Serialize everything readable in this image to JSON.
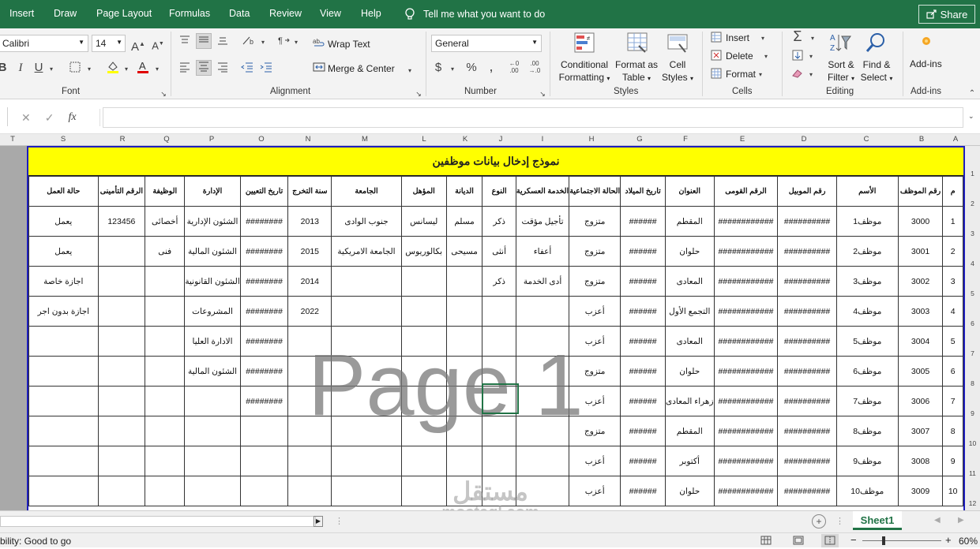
{
  "menu": {
    "tabs": [
      "Insert",
      "Draw",
      "Page Layout",
      "Formulas",
      "Data",
      "Review",
      "View",
      "Help"
    ],
    "tell_me": "Tell me what you want to do",
    "share": "Share"
  },
  "ribbon": {
    "font_name": "Calibri",
    "font_size": "14",
    "bold": "B",
    "italic": "I",
    "underline": "U",
    "wrap_text": "Wrap Text",
    "merge_center": "Merge & Center",
    "number_format": "General",
    "conditional_formatting": [
      "Conditional",
      "Formatting"
    ],
    "format_as_table": [
      "Format as",
      "Table"
    ],
    "cell_styles": [
      "Cell",
      "Styles"
    ],
    "insert": "Insert",
    "delete": "Delete",
    "format": "Format",
    "sort_filter": [
      "Sort &",
      "Filter"
    ],
    "find_select": [
      "Find &",
      "Select"
    ],
    "addins": "Add-ins",
    "groups": {
      "font": "Font",
      "alignment": "Alignment",
      "number": "Number",
      "styles": "Styles",
      "cells": "Cells",
      "editing": "Editing",
      "addins": "Add-ins"
    }
  },
  "formula_bar": {
    "fx": "fx",
    "value": ""
  },
  "columns": [
    "T",
    "S",
    "R",
    "Q",
    "P",
    "O",
    "N",
    "M",
    "L",
    "K",
    "J",
    "I",
    "H",
    "G",
    "F",
    "E",
    "D",
    "C",
    "B",
    "A"
  ],
  "row_numbers": [
    "1",
    "2",
    "3",
    "4",
    "5",
    "6",
    "7",
    "8",
    "9",
    "10",
    "11",
    "12"
  ],
  "sheet": {
    "title": "نموذج إدخال بيانات موظفين",
    "headers": [
      "حالة العمل",
      "الرقم التأمينى",
      "الوظيفة",
      "الإدارة",
      "تاريخ التعيين",
      "سنة التخرج",
      "الجامعة",
      "المؤهل",
      "الديانة",
      "النوع",
      "الخدمة العسكرية",
      "الحالة الاجتماعية",
      "تاريخ الميلاد",
      "العنوان",
      "الرقم القومى",
      "رقم الموبيل",
      "الأسم",
      "رقم الموظف",
      "م"
    ],
    "rows": [
      [
        "يعمل",
        "123456",
        "أخصائى",
        "الشئون الإدارية",
        "########",
        "2013",
        "جنوب الوادى",
        "ليسانس",
        "مسلم",
        "ذكر",
        "تأجيل مؤقت",
        "متزوج",
        "######",
        "المقطم",
        "############",
        "##########",
        "موظف1",
        "3000",
        "1"
      ],
      [
        "يعمل",
        "",
        "فنى",
        "الشئون المالية",
        "########",
        "2015",
        "الجامعة الامريكية",
        "بكالوريوس",
        "مسيحى",
        "أنثى",
        "أعفاء",
        "متزوج",
        "######",
        "حلوان",
        "############",
        "##########",
        "موظف2",
        "3001",
        "2"
      ],
      [
        "اجازة خاصة",
        "",
        "",
        "الشئون القانونية",
        "########",
        "2014",
        "",
        "",
        "",
        "ذكر",
        "أدى الخدمة",
        "متزوج",
        "######",
        "المعادى",
        "############",
        "##########",
        "موظف3",
        "3002",
        "3"
      ],
      [
        "اجازة بدون اجر",
        "",
        "",
        "المشروعات",
        "########",
        "2022",
        "",
        "",
        "",
        "",
        "",
        "أعزب",
        "######",
        "التجمع الأول",
        "############",
        "##########",
        "موظف4",
        "3003",
        "4"
      ],
      [
        "",
        "",
        "",
        "الادارة العليا",
        "########",
        "",
        "",
        "",
        "",
        "",
        "",
        "أعزب",
        "######",
        "المعادى",
        "############",
        "##########",
        "موظف5",
        "3004",
        "5"
      ],
      [
        "",
        "",
        "",
        "الشئون المالية",
        "########",
        "",
        "",
        "",
        "",
        "",
        "",
        "متزوج",
        "######",
        "حلوان",
        "############",
        "##########",
        "موظف6",
        "3005",
        "6"
      ],
      [
        "",
        "",
        "",
        "",
        "########",
        "",
        "",
        "",
        "",
        "",
        "",
        "أعزب",
        "######",
        "زهراء المعادى",
        "############",
        "##########",
        "موظف7",
        "3006",
        "7"
      ],
      [
        "",
        "",
        "",
        "",
        "",
        "",
        "",
        "",
        "",
        "",
        "",
        "متزوج",
        "######",
        "المقطم",
        "############",
        "##########",
        "موظف8",
        "3007",
        "8"
      ],
      [
        "",
        "",
        "",
        "",
        "",
        "",
        "",
        "",
        "",
        "",
        "",
        "أعزب",
        "######",
        "أكتوبر",
        "############",
        "##########",
        "موظف9",
        "3008",
        "9"
      ],
      [
        "",
        "",
        "",
        "",
        "",
        "",
        "",
        "",
        "",
        "",
        "",
        "أعزب",
        "######",
        "حلوان",
        "############",
        "##########",
        "موظف10",
        "3009",
        "10"
      ]
    ],
    "watermark": "Page 1"
  },
  "sheet_tab": "Sheet1",
  "status": {
    "text": "bility: Good to go",
    "zoom": "60%"
  },
  "logo": {
    "arabic": "مستقل",
    "latin": "mostaql.com"
  }
}
